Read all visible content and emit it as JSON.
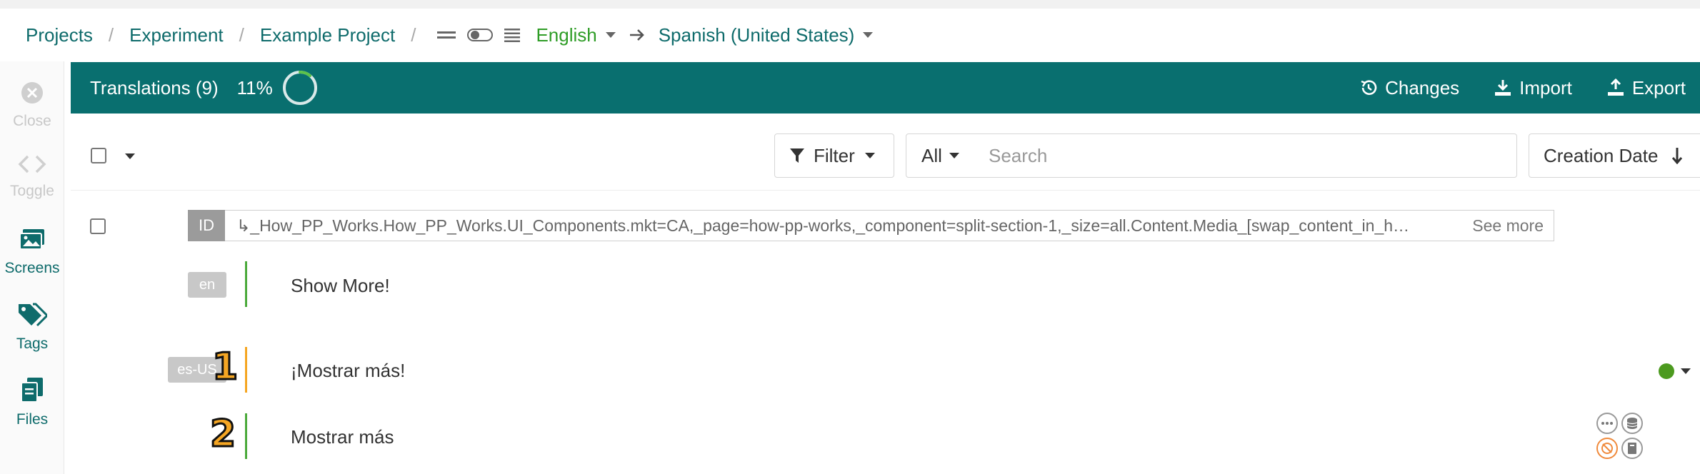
{
  "breadcrumb": {
    "items": [
      "Projects",
      "Experiment",
      "Example Project"
    ],
    "separator": "/",
    "source_language": "English",
    "target_language": "Spanish (United States)"
  },
  "sidebar": {
    "items": [
      {
        "label": "Close",
        "icon": "close-circle-icon",
        "enabled": false
      },
      {
        "label": "Toggle",
        "icon": "code-brackets-icon",
        "enabled": false
      },
      {
        "label": "Screens",
        "icon": "images-icon",
        "enabled": true
      },
      {
        "label": "Tags",
        "icon": "tags-icon",
        "enabled": true
      },
      {
        "label": "Files",
        "icon": "files-icon",
        "enabled": true
      }
    ]
  },
  "header": {
    "title": "Translations (9)",
    "progress_label": "11%",
    "progress": 0.11,
    "actions": [
      {
        "label": "Changes",
        "icon": "history-icon"
      },
      {
        "label": "Import",
        "icon": "import-icon"
      },
      {
        "label": "Export",
        "icon": "export-icon"
      }
    ],
    "color": "#096f6f"
  },
  "toolbar": {
    "filter_label": "Filter",
    "scope_label": "All",
    "search_placeholder": "Search",
    "sort_label": "Creation Date"
  },
  "row": {
    "id_label": "ID",
    "key": "↳_How_PP_Works.How_PP_Works.UI_Components.mkt=CA,_page=how-pp-works,_component=split-section-1,_size=all.Content.Media_[swap_content_in_h…",
    "see_more": "See more",
    "source": {
      "lang": "en",
      "text": "Show More!"
    },
    "target": {
      "lang": "es-US",
      "text": "¡Mostrar más!",
      "status_color": "#4c9a1f"
    },
    "suggestion": {
      "text": "Mostrar más"
    }
  },
  "annotations": [
    "1",
    "2"
  ],
  "colors": {
    "teal": "#0e6b6b",
    "green": "#2f9d27",
    "orange": "#f5a623"
  }
}
